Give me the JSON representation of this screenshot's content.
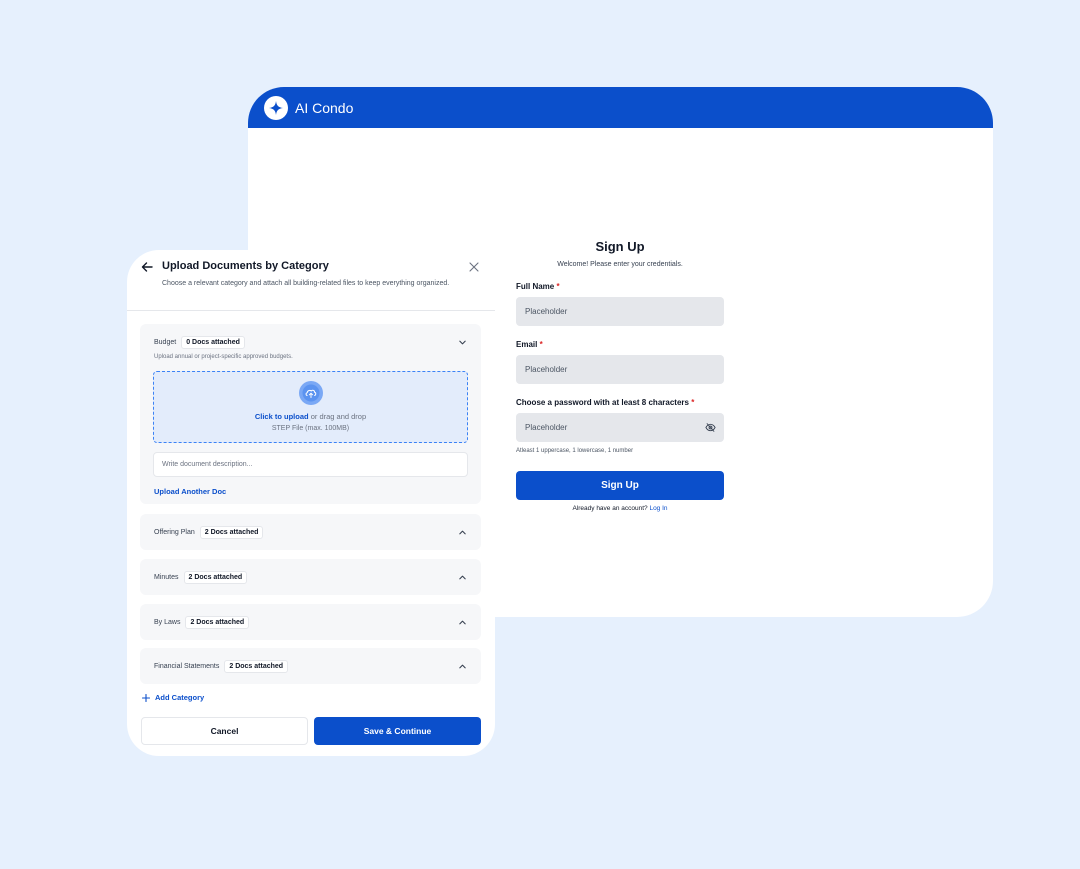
{
  "app": {
    "name": "AI Condo"
  },
  "signup": {
    "title": "Sign Up",
    "subtitle": "Welcome! Please enter your credentials.",
    "fields": [
      {
        "label": "Full Name",
        "required_mark": "*",
        "placeholder": "Placeholder"
      },
      {
        "label": "Email",
        "required_mark": "*",
        "placeholder": "Placeholder"
      },
      {
        "label": "Choose a password with at least 8 characters",
        "required_mark": "*",
        "placeholder": "Placeholder"
      }
    ],
    "password_hint": "Atleast 1 uppercase, 1 lowercase, 1 number",
    "submit_label": "Sign Up",
    "login_prompt": "Already have an account?",
    "login_link": "Log In"
  },
  "upload": {
    "title": "Upload Documents by Category",
    "description": "Choose a relevant category and attach all building-related files to keep everything organized.",
    "categories": [
      {
        "name": "Budget",
        "badge": "0 Docs attached",
        "hint": "Upload annual or project-specific approved budgets.",
        "expanded": true
      },
      {
        "name": "Offering Plan",
        "badge": "2 Docs attached",
        "expanded": false
      },
      {
        "name": "Minutes",
        "badge": "2 Docs attached",
        "expanded": false
      },
      {
        "name": "By Laws",
        "badge": "2 Docs attached",
        "expanded": false
      },
      {
        "name": "Financial Statements",
        "badge": "2 Docs attached",
        "expanded": false
      }
    ],
    "dropzone": {
      "link_text": "Click to upload",
      "rest_text": " or drag and drop",
      "file_hint": "STEP File (max. 100MB)"
    },
    "description_placeholder": "Write document description...",
    "upload_another": "Upload Another Doc",
    "add_category": "Add Category",
    "cancel_label": "Cancel",
    "save_label": "Save & Continue"
  },
  "colors": {
    "brand": "#0b4fcb",
    "background": "#e6f0fd",
    "required": "#dc2626"
  }
}
